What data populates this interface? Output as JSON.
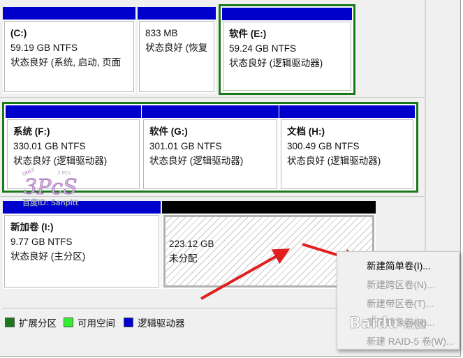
{
  "disk_row_1": {
    "partitions": [
      {
        "title": "(C:)",
        "size": "59.19 GB NTFS",
        "status": "状态良好 (系统, 启动, 页面"
      },
      {
        "title": "",
        "size": "833 MB",
        "status": "状态良好 (恢复"
      },
      {
        "title": "软件  (E:)",
        "size": "59.24 GB NTFS",
        "status": "状态良好 (逻辑驱动器)"
      }
    ]
  },
  "disk_row_2": {
    "partitions": [
      {
        "title": "系统  (F:)",
        "size": "330.01 GB NTFS",
        "status": "状态良好 (逻辑驱动器)"
      },
      {
        "title": "软件  (G:)",
        "size": "301.01 GB NTFS",
        "status": "状态良好 (逻辑驱动器)"
      },
      {
        "title": "文档  (H:)",
        "size": "300.49 GB NTFS",
        "status": "状态良好 (逻辑驱动器)"
      }
    ]
  },
  "disk_row_3": {
    "partitions": [
      {
        "title": "新加卷  (I:)",
        "size": "9.77 GB NTFS",
        "status": "状态良好 (主分区)"
      },
      {
        "title": "",
        "size": "223.12 GB",
        "status": "未分配"
      }
    ]
  },
  "legend": {
    "items": [
      {
        "label": "扩展分区",
        "color": "#1a7a1a"
      },
      {
        "label": "可用空间",
        "color": "#33ee33"
      },
      {
        "label": "逻辑驱动器",
        "color": "#0000cc"
      }
    ]
  },
  "context_menu": {
    "items": [
      {
        "label": "新建简单卷(I)...",
        "enabled": true
      },
      {
        "label": "新建跨区卷(N)...",
        "enabled": false
      },
      {
        "label": "新建带区卷(T)...",
        "enabled": false
      },
      {
        "label": "新建镜像卷(R)...",
        "enabled": false
      },
      {
        "label": "新建 RAID-5 卷(W)...",
        "enabled": false
      }
    ]
  },
  "watermarks": {
    "logo_text": "3PcS",
    "logo_small": "ONLY",
    "logo_tag": "3 PCs",
    "logo_caption": "百度ID: Sanpitt",
    "baidu_text": "Baidu",
    "baidu_sub": "经验"
  },
  "colors": {
    "logical_drive": "#0000cc",
    "extended": "#1a7a1a",
    "free_space": "#33ee33",
    "arrow": "#e02020"
  }
}
